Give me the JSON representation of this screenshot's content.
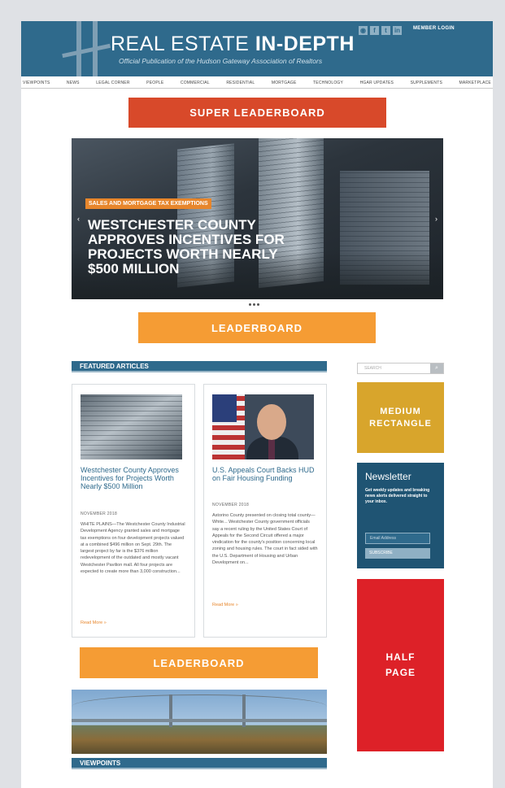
{
  "header": {
    "title_normal": "REAL ESTATE ",
    "title_bold": "IN-DEPTH",
    "subtitle": "Official Publication of the Hudson Gateway Association of Realtors",
    "social": [
      "rss",
      "f",
      "t",
      "in"
    ],
    "member_login": "MEMBER LOGIN"
  },
  "nav": [
    "VIEWPOINTS",
    "NEWS",
    "LEGAL CORNER",
    "PEOPLE",
    "COMMERCIAL",
    "RESIDENTIAL",
    "MORTGAGE",
    "TECHNOLOGY",
    "HGAR UPDATES",
    "SUPPLEMENTS",
    "MARKETPLACE"
  ],
  "ads": {
    "super": "SUPER LEADERBOARD",
    "leaderboard_1": "LEADERBOARD",
    "leaderboard_2": "LEADERBOARD",
    "medium_1": "MEDIUM",
    "medium_2": "RECTANGLE",
    "half_1": "HALF",
    "half_2": "PAGE"
  },
  "hero": {
    "tag": "SALES AND MORTGAGE TAX EXEMPTIONS",
    "headline": "WESTCHESTER COUNTY APPROVES INCENTIVES FOR PROJECTS WORTH NEARLY $500 MILLION"
  },
  "featured": {
    "label": "FEATURED ARTICLES",
    "articles": [
      {
        "title": "Westchester County Approves Incentives for Projects Worth Nearly $500 Million",
        "date": "NOVEMBER 2018",
        "body": "WHITE PLAINS—The Westchester County Industrial Development Agency granted sales and mortgage tax exemptions on four development projects valued at a combined $496 million on Sept. 29th. The largest project by far is the $376 million redevelopment of the outdated and mostly vacant Westchester Pavilion mall. All four projects are expected to create more than 3,000 construction...",
        "more": "Read More »"
      },
      {
        "title": "U.S. Appeals Court Backs HUD on Fair Housing Funding",
        "date": "NOVEMBER 2018",
        "body": "Astorino County presented on closing total county—White... Westchester County government officials say a recent ruling by the United States Court of Appeals for the Second Circuit offered a major vindication for the county's position concerning local zoning and housing rules. The court in fact sided with the U.S. Department of Housing and Urban Development on...",
        "more": "Read More »"
      }
    ]
  },
  "sidebar": {
    "search_placeholder": "SEARCH",
    "newsletter_title": "Newsletter",
    "newsletter_text": "Get weekly updates and breaking news alerts delivered straight to your inbox.",
    "email_placeholder": "Email Address",
    "subscribe": "SUBSCRIBE"
  },
  "viewpoints": {
    "label": "VIEWPOINTS"
  }
}
